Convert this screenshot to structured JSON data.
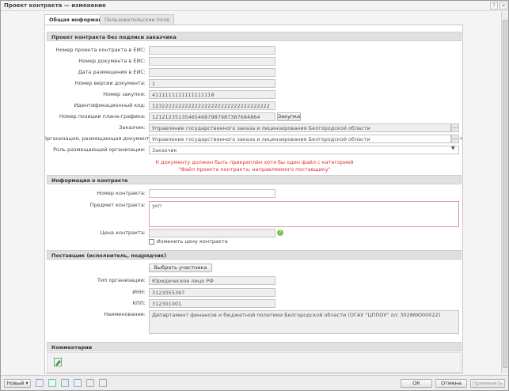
{
  "window": {
    "title": "Проект контракта — изменение",
    "help": "?",
    "close": "×"
  },
  "tabs": [
    "Общая информация",
    "Пользовательские поля"
  ],
  "project": {
    "section": "Проект контракта без подписи заказчика",
    "fields": [
      {
        "label": "Номер проекта контракта в ЕИС:",
        "value": ""
      },
      {
        "label": "Номер документа в ЕИС:",
        "value": ""
      },
      {
        "label": "Дата размещения в ЕИС:",
        "value": ""
      },
      {
        "label": "Номер версии документа:",
        "value": "1"
      },
      {
        "label": "Номер закупки:",
        "value": "4111111111111111118"
      },
      {
        "label": "Идентификационный код:",
        "value": "123222222222222222222222222222222222"
      },
      {
        "label": "Номер позиции плана-графика:",
        "value": "121212351354654687987987387684864"
      }
    ],
    "purchase_button": "Закупка",
    "customer_label": "Заказчик:",
    "customer_value": "Управление государственного заказа и лицензирования Белгородской области",
    "placing_org_label": "Организация, размещающая документ:",
    "placing_org_value": "Управление государственного заказа и лицензирования Белгородской области",
    "role_label": "Роль размещающей организации:",
    "role_value": "Заказчик",
    "warning_line1": "К документу должен быть прикреплён хотя бы один файл с категорией",
    "warning_line2": "\"Файл проекта контракта, направляемого поставщику\""
  },
  "contract": {
    "section": "Информация о контракте",
    "number_label": "Номер контракта:",
    "number_value": "",
    "subject_label": "Предмет контракта:",
    "subject_value": "укп",
    "price_label": "Цена контракта:",
    "price_value": "",
    "change_price_label": "Изменить цену контракта"
  },
  "supplier": {
    "section": "Поставщик (исполнитель, подрядчик)",
    "choose_button": "Выбрать участника",
    "type_label": "Тип организации:",
    "type_value": "Юридическое лицо РФ",
    "inn_label": "ИНН:",
    "inn_value": "3123055397",
    "kpp_label": "КПП:",
    "kpp_value": "312301001",
    "name_label": "Наименование:",
    "name_value": "Департамент финансов и бюджетной политики Белгородской области (ОГАУ \"ЦППОУ\" л/с 30286Ю00022)"
  },
  "comments": {
    "section": "Комментарии"
  },
  "footer": {
    "new_button": "Новый",
    "ok_button": "ОК",
    "cancel_button": "Отмена",
    "apply_button": "Применить"
  }
}
